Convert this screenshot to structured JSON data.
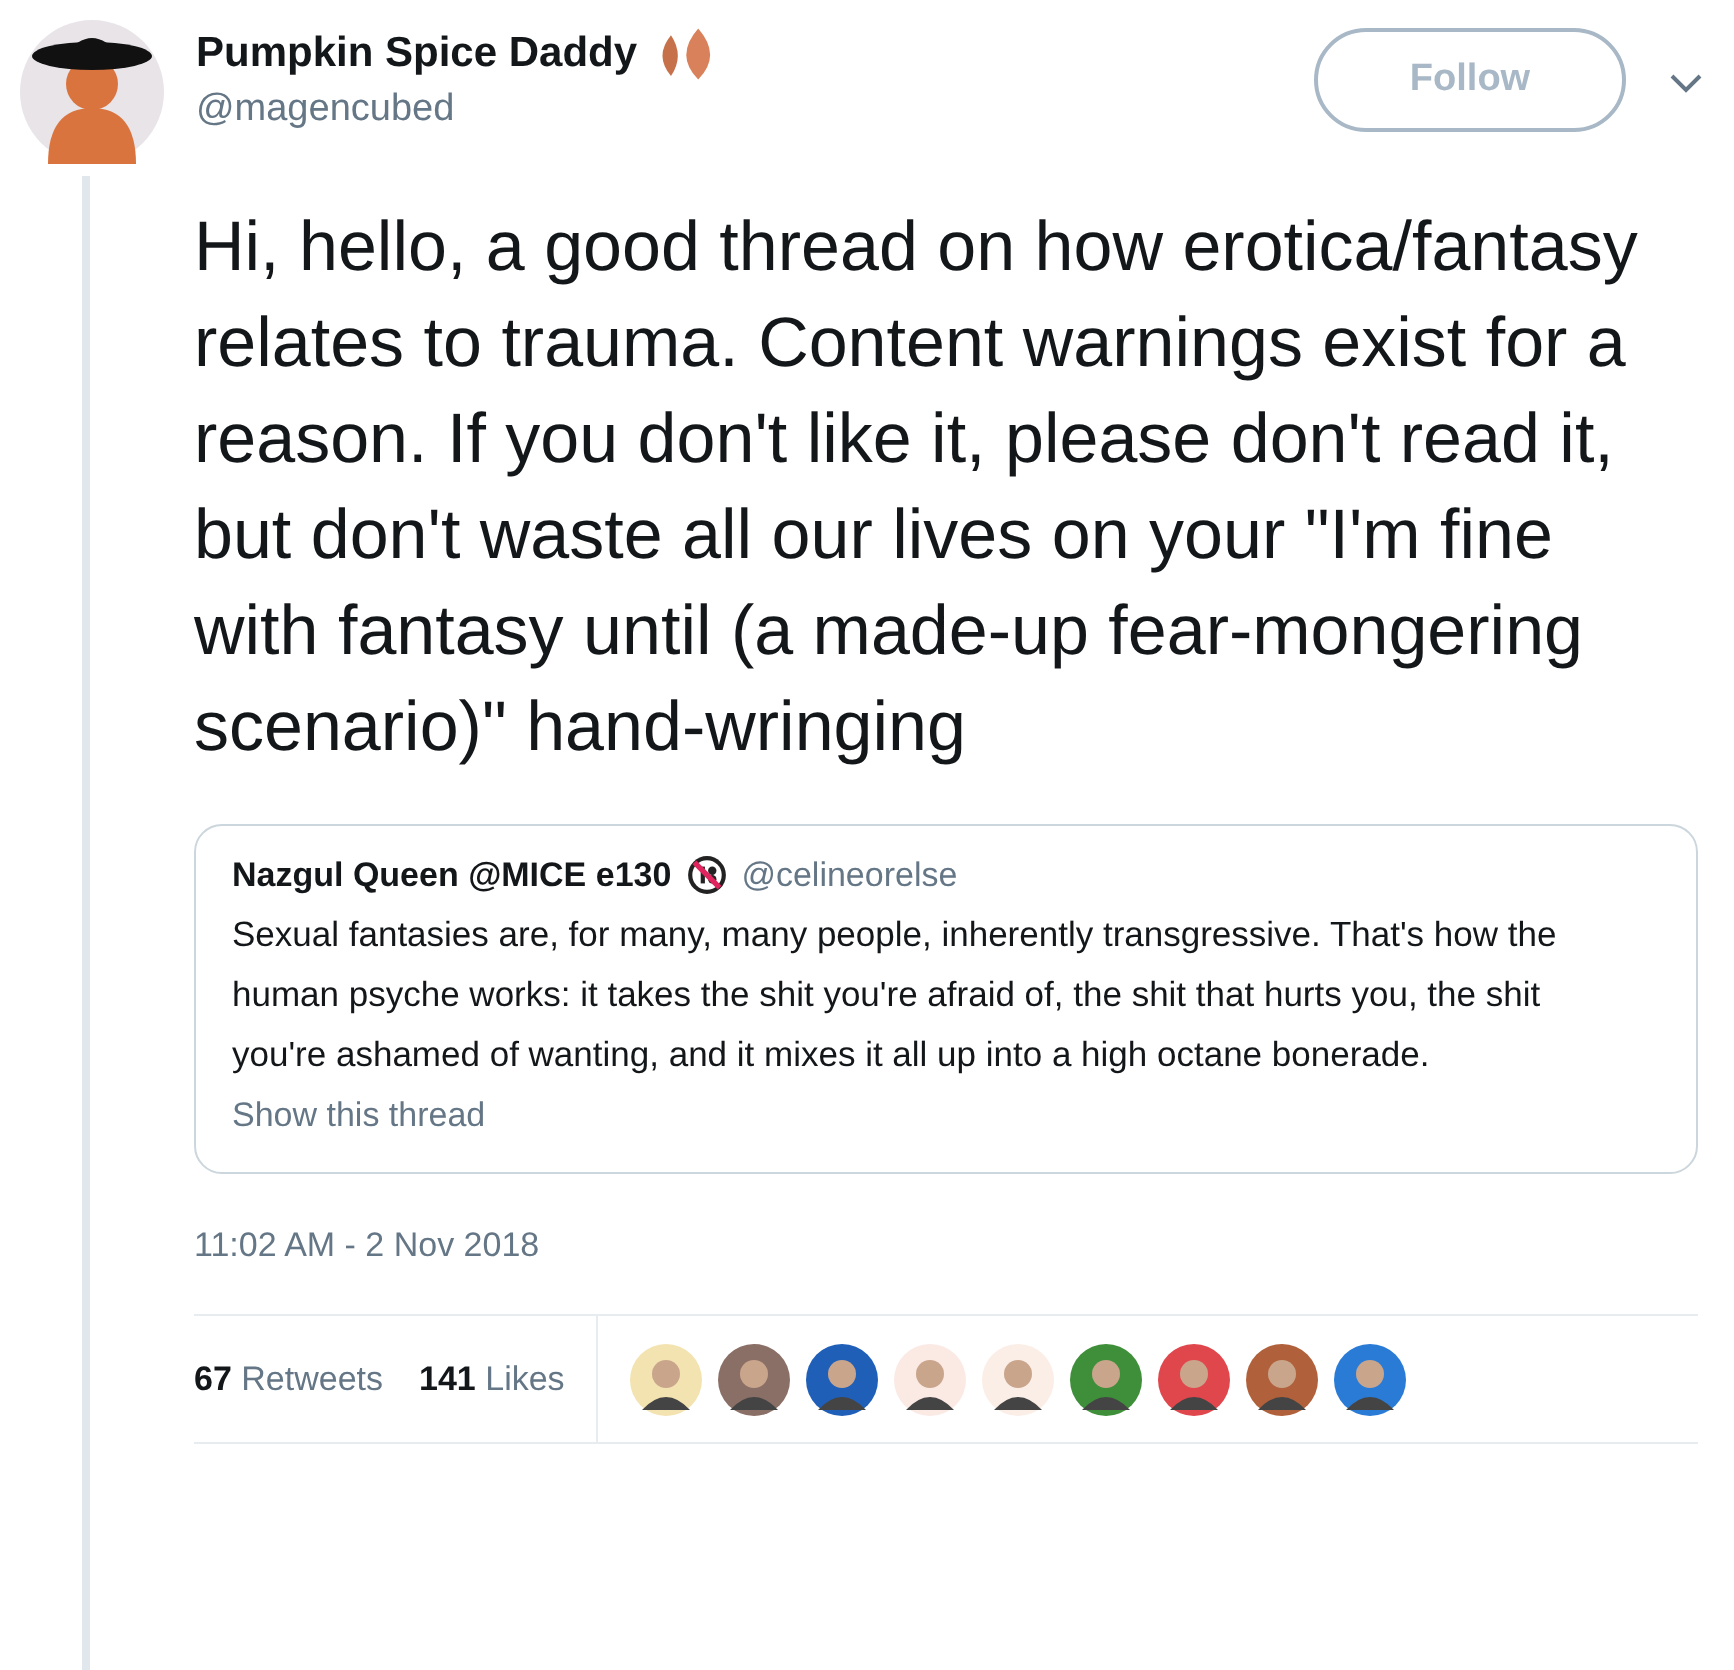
{
  "author": {
    "name": "Pumpkin Spice Daddy",
    "handle": "@magencubed"
  },
  "follow_button": {
    "label": "Follow"
  },
  "tweet_text": "Hi, hello, a good thread on how erotica/fantasy relates to trauma. Content warnings exist for a reason. If you don't like it, please don't read it, but don't waste all our lives on your \"I'm fine with fantasy until (a made-up fear-mongering scenario)\" hand-wringing",
  "quoted_tweet": {
    "name": "Nazgul Queen @MICE e130",
    "handle": "@celineorelse",
    "text": "Sexual fantasies are, for many, many people, inherently transgressive. That's how the human psyche works: it takes the shit you're afraid of, the shit that hurts you, the shit you're ashamed of wanting, and it mixes it all up into a high octane bonerade.",
    "thread_link": "Show this thread"
  },
  "timestamp": "11:02 AM - 2 Nov 2018",
  "stats": [
    {
      "count": "67",
      "label": "Retweets"
    },
    {
      "count": "141",
      "label": "Likes"
    }
  ],
  "likers": [
    {
      "color": "#f3e3b0"
    },
    {
      "color": "#8a6f66"
    },
    {
      "color": "#1f5fb8"
    },
    {
      "color": "#fbe9e4"
    },
    {
      "color": "#fbeee6"
    },
    {
      "color": "#3f8f3a"
    },
    {
      "color": "#e0474c"
    },
    {
      "color": "#b0603a"
    },
    {
      "color": "#2a7bd6"
    }
  ]
}
